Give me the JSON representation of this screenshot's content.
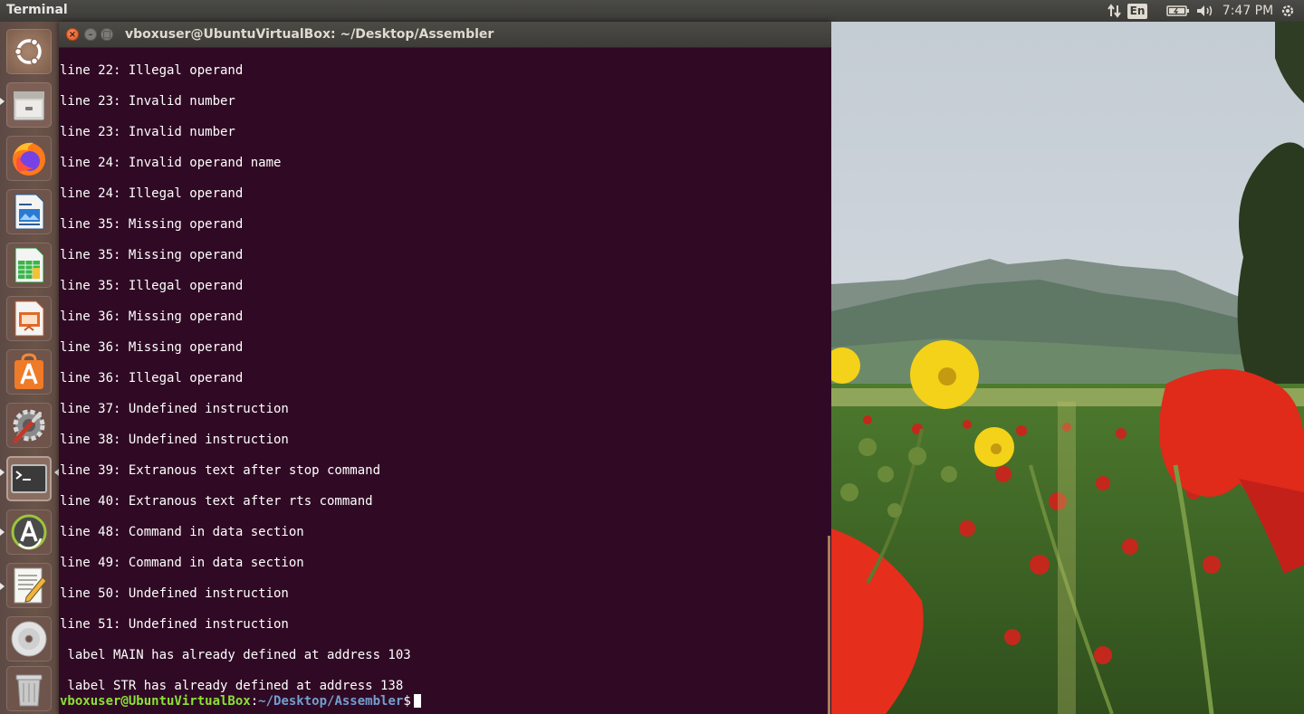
{
  "top_panel": {
    "app_title": "Terminal",
    "language": "En",
    "clock": "7:47 PM",
    "icons": [
      "network-updown-icon",
      "keyboard-language-icon",
      "battery-icon",
      "volume-icon",
      "power-gear-icon"
    ]
  },
  "launcher": {
    "items": [
      {
        "name": "ubuntu-dash-icon"
      },
      {
        "name": "files-icon"
      },
      {
        "name": "firefox-icon"
      },
      {
        "name": "libreoffice-writer-icon"
      },
      {
        "name": "libreoffice-calc-icon"
      },
      {
        "name": "libreoffice-impress-icon"
      },
      {
        "name": "ubuntu-software-icon"
      },
      {
        "name": "system-settings-icon"
      },
      {
        "name": "terminal-icon"
      },
      {
        "name": "software-updater-icon"
      },
      {
        "name": "text-editor-icon"
      },
      {
        "name": "dvd-drive-icon"
      },
      {
        "name": "trash-icon"
      }
    ]
  },
  "window": {
    "title": "vboxuser@UbuntuVirtualBox: ~/Desktop/Assembler",
    "close_glyph": "×",
    "minimize_glyph": "–",
    "maximize_glyph": "□"
  },
  "terminal": {
    "lines": [
      "line 22: Illegal operand",
      "line 23: Invalid number",
      "line 23: Invalid number",
      "line 24: Invalid operand name",
      "line 24: Illegal operand",
      "line 35: Missing operand",
      "line 35: Missing operand",
      "line 35: Illegal operand",
      "line 36: Missing operand",
      "line 36: Missing operand",
      "line 36: Illegal operand",
      "line 37: Undefined instruction",
      "line 38: Undefined instruction",
      "line 39: Extranous text after stop command",
      "line 40: Extranous text after rts command",
      "line 48: Command in data section",
      "line 49: Command in data section",
      "line 50: Undefined instruction",
      "line 51: Undefined instruction",
      " label MAIN has already defined at address 103",
      " label STR has already defined at address 138"
    ],
    "prompt_user": "vboxuser@UbuntuVirtualBox",
    "prompt_sep": ":",
    "prompt_path": "~/Desktop/Assembler",
    "prompt_symbol": "$"
  },
  "colors": {
    "terminal_bg": "#300a24",
    "prompt_user": "#8ae234",
    "prompt_path": "#729fcf",
    "panel_bg": "#3c3b37",
    "close_button": "#e2571e"
  }
}
